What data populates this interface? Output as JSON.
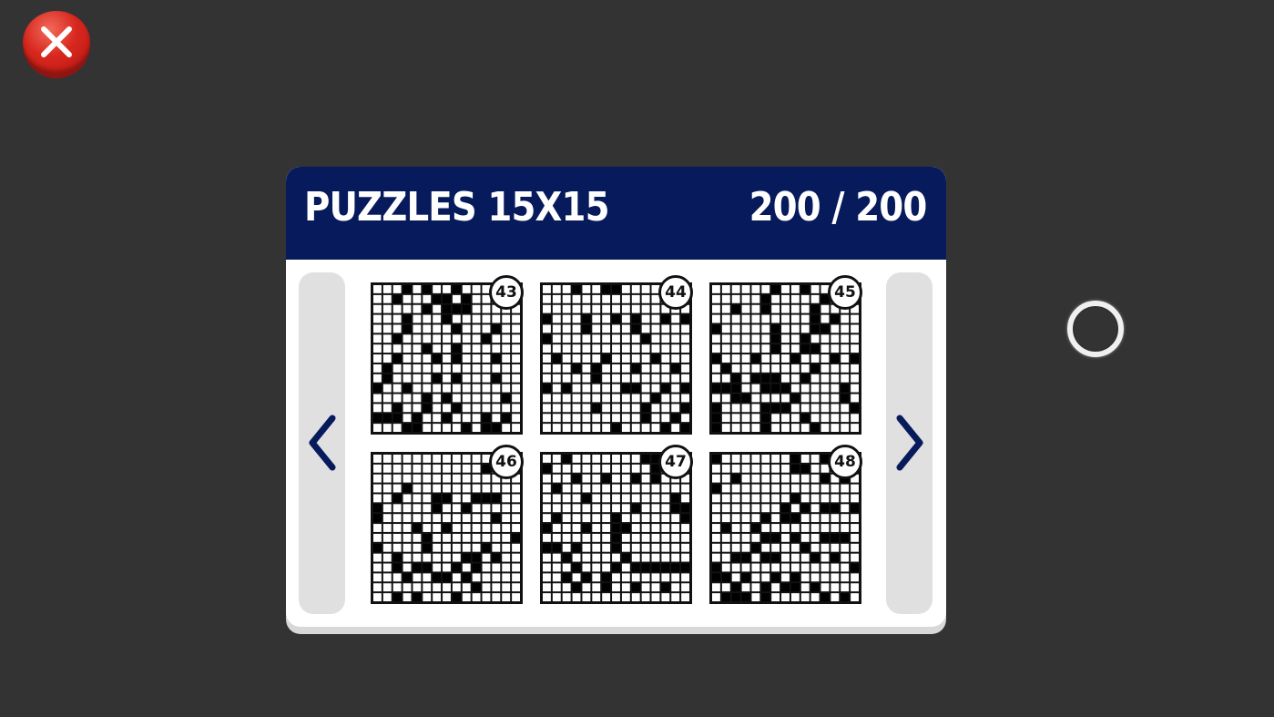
{
  "header": {
    "title": "PUZZLES 15X15",
    "progress": "200 / 200"
  },
  "icons": {
    "close": "close-icon",
    "prev": "chevron-left-icon",
    "next": "chevron-right-icon",
    "indicator": "ring-icon"
  },
  "colors": {
    "header_bg": "#061a5c",
    "close_button": "#d8281f",
    "background": "#333333"
  },
  "puzzles": [
    {
      "number": "43"
    },
    {
      "number": "44"
    },
    {
      "number": "45"
    },
    {
      "number": "46"
    },
    {
      "number": "47"
    },
    {
      "number": "48"
    }
  ]
}
